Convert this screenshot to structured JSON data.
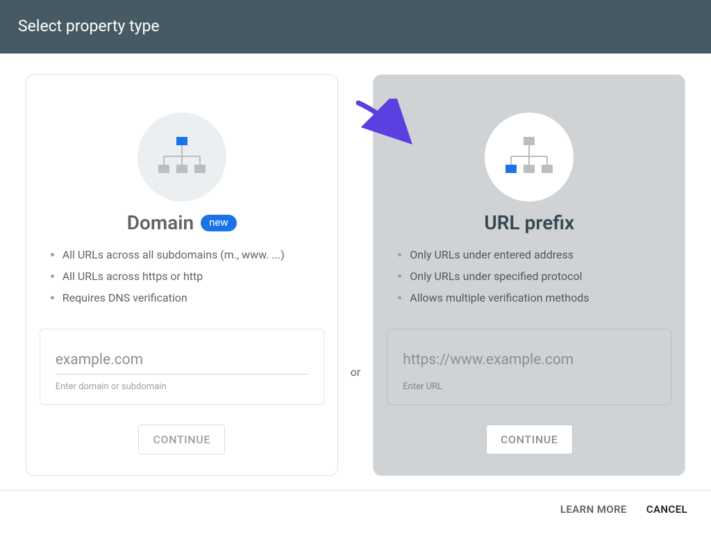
{
  "header": {
    "title": "Select property type"
  },
  "or_label": "or",
  "domain": {
    "title": "Domain",
    "badge": "new",
    "bullets": [
      "All URLs across all subdomains (m., www. ...)",
      "All URLs across https or http",
      "Requires DNS verification"
    ],
    "input_placeholder": "example.com",
    "helper": "Enter domain or subdomain",
    "continue_label": "CONTINUE"
  },
  "url_prefix": {
    "title": "URL prefix",
    "bullets": [
      "Only URLs under entered address",
      "Only URLs under specified protocol",
      "Allows multiple verification methods"
    ],
    "input_placeholder": "https://www.example.com",
    "helper": "Enter URL",
    "continue_label": "CONTINUE"
  },
  "footer": {
    "learn_more": "LEARN MORE",
    "cancel": "CANCEL"
  }
}
